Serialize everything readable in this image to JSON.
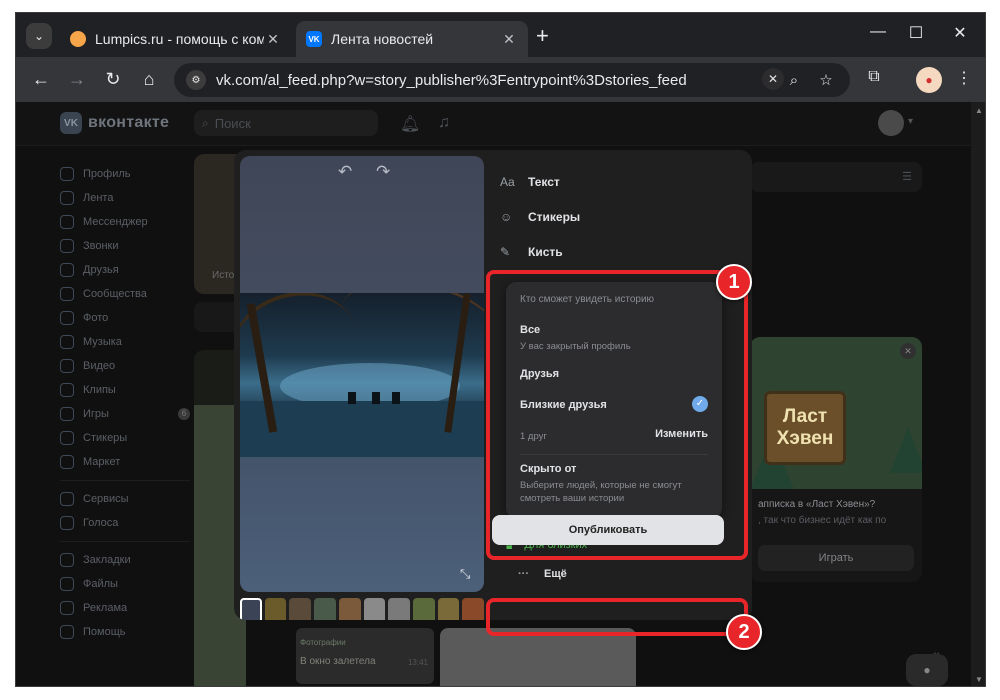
{
  "browser": {
    "tabs": [
      {
        "title": "Lumpics.ru - помощь с компь",
        "favicon": "lumpics-orange-icon"
      },
      {
        "title": "Лента новостей",
        "favicon": "vk-icon"
      }
    ],
    "url": "vk.com/al_feed.php?w=story_publisher%3Fentrypoint%3Dstories_feed"
  },
  "vk": {
    "logo_text": "вконтакте",
    "search_placeholder": "Поиск",
    "sidebar": [
      {
        "label": "Профиль",
        "icon": "profile-icon"
      },
      {
        "label": "Лента",
        "icon": "feed-icon"
      },
      {
        "label": "Мессенджер",
        "icon": "messenger-icon"
      },
      {
        "label": "Звонки",
        "icon": "calls-icon"
      },
      {
        "label": "Друзья",
        "icon": "friends-icon"
      },
      {
        "label": "Сообщества",
        "icon": "communities-icon"
      },
      {
        "label": "Фото",
        "icon": "photo-icon"
      },
      {
        "label": "Музыка",
        "icon": "music-icon"
      },
      {
        "label": "Видео",
        "icon": "video-icon"
      },
      {
        "label": "Клипы",
        "icon": "clips-icon"
      },
      {
        "label": "Игры",
        "icon": "games-icon",
        "badge": "6"
      },
      {
        "label": "Стикеры",
        "icon": "stickers-icon"
      },
      {
        "label": "Маркет",
        "icon": "market-icon"
      },
      {
        "label": "Сервисы",
        "icon": "services-icon"
      },
      {
        "label": "Голоса",
        "icon": "votes-icon"
      },
      {
        "label": "Закладки",
        "icon": "bookmarks-icon"
      },
      {
        "label": "Файлы",
        "icon": "files-icon"
      },
      {
        "label": "Реклама",
        "icon": "ads-icon"
      },
      {
        "label": "Помощь",
        "icon": "help-icon"
      }
    ],
    "stories_label": "Исто",
    "game_card": {
      "logo_line1": "Ласт",
      "logo_line2": "Хэвен",
      "title": "апписка в «Ласт Хэвен»?",
      "subtitle": ", так что бизнес идёт как по",
      "button": "Играть"
    },
    "chat_preview": {
      "sender": "Фотографии",
      "message": "В окно залетела",
      "time": "13:41"
    }
  },
  "editor": {
    "tools": [
      {
        "label": "Текст",
        "icon": "text-tool-icon",
        "glyph": "Aa"
      },
      {
        "label": "Стикеры",
        "icon": "stickers-tool-icon",
        "glyph": "☺"
      },
      {
        "label": "Кисть",
        "icon": "brush-tool-icon",
        "glyph": "✎"
      }
    ],
    "privacy_menu": {
      "header": "Кто сможет увидеть историю",
      "everyone": "Все",
      "everyone_sub": "У вас закрытый профиль",
      "friends": "Друзья",
      "close_friends": "Близкие друзья",
      "close_friends_selected": true,
      "count": "1 друг",
      "change": "Изменить",
      "hidden_from": "Скрыто от",
      "hidden_from_sub": "Выберите людей, которые не смогут смотреть ваши истории"
    },
    "privacy_current": "Для близких",
    "more_label": "Ещё",
    "publish_label": "Опубликовать",
    "thumbnail_count": 10
  },
  "annotations": [
    {
      "number": "1"
    },
    {
      "number": "2"
    }
  ],
  "colors": {
    "accent_green": "#4bb34b",
    "check_blue": "#71aaeb",
    "annotation_red": "#e8262a"
  }
}
